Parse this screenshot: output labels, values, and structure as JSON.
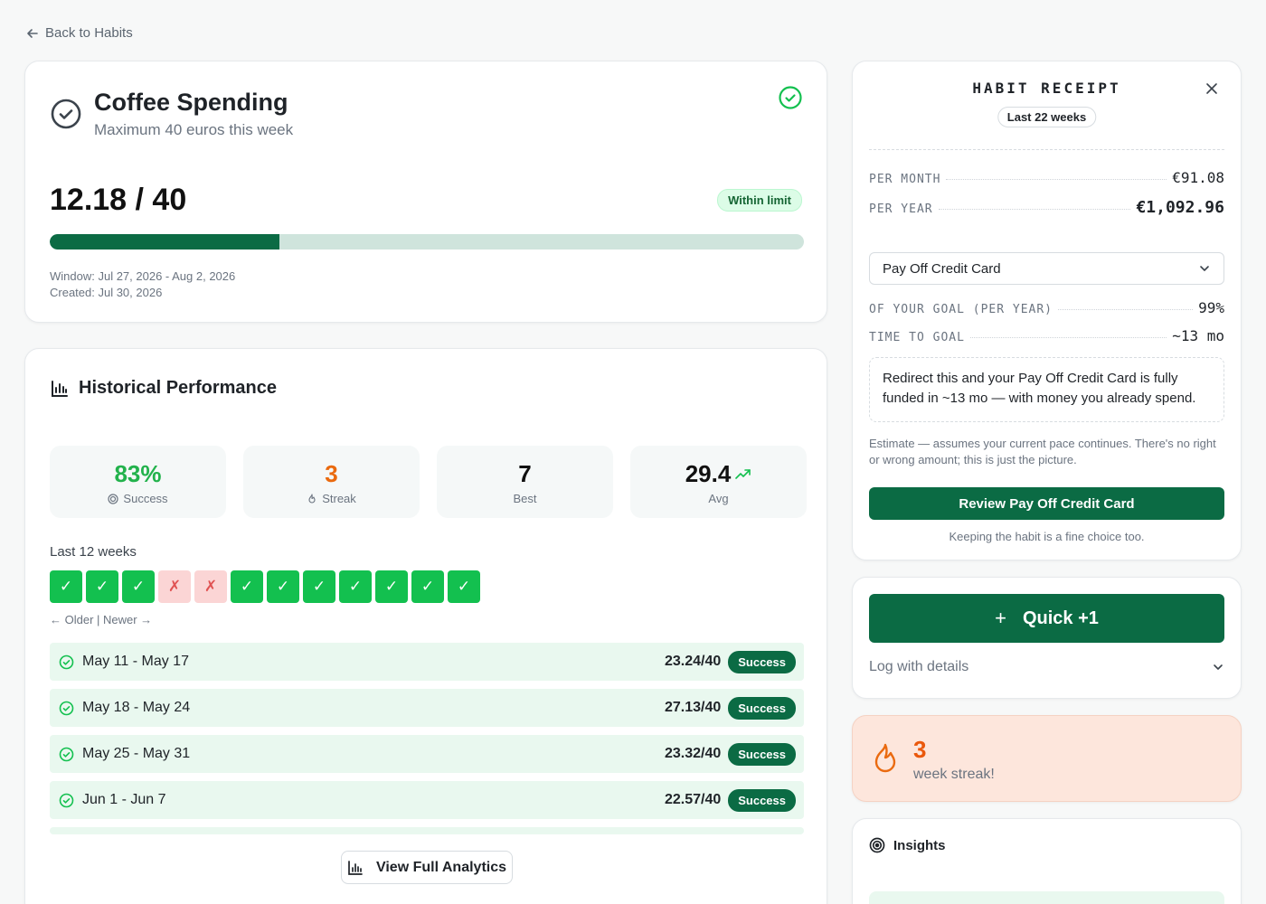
{
  "nav": {
    "back_label": "Back to Habits"
  },
  "habit": {
    "title": "Coffee Spending",
    "subtitle": "Maximum 40 euros this week",
    "value_display": "12.18 / 40",
    "status_badge": "Within limit",
    "progress_fraction": 0.3045,
    "window": "Window: Jul 27, 2026 - Aug 2, 2026",
    "created": "Created: Jul 30, 2026"
  },
  "history": {
    "title": "Historical Performance",
    "stats": {
      "success": {
        "value": "83%",
        "label": "Success"
      },
      "streak": {
        "value": "3",
        "label": "Streak"
      },
      "best": {
        "value": "7",
        "label": "Best"
      },
      "avg": {
        "value": "29.4",
        "label": "Avg"
      }
    },
    "last12_label": "Last 12 weeks",
    "weeks": [
      "✓",
      "✓",
      "✓",
      "✗",
      "✗",
      "✓",
      "✓",
      "✓",
      "✓",
      "✓",
      "✓",
      "✓"
    ],
    "older_newer": "← Older | Newer →",
    "rows": [
      {
        "label": "May 11 - May 17",
        "value": "23.24/40",
        "badge": "Success"
      },
      {
        "label": "May 18 - May 24",
        "value": "27.13/40",
        "badge": "Success"
      },
      {
        "label": "May 25 - May 31",
        "value": "23.32/40",
        "badge": "Success"
      },
      {
        "label": "Jun 1 - Jun 7",
        "value": "22.57/40",
        "badge": "Success"
      }
    ],
    "view_full_label": "View Full Analytics"
  },
  "receipt": {
    "title": "HABIT RECEIPT",
    "period_pill": "Last 22 weeks",
    "per_month_label": "PER MONTH",
    "per_month_value": "€91.08",
    "per_year_label": "PER YEAR",
    "per_year_value": "€1,092.96",
    "goal_select": "Pay Off Credit Card",
    "goal_pct_label": "OF YOUR GOAL (PER YEAR)",
    "goal_pct_value": "99%",
    "time_label": "TIME TO GOAL",
    "time_value": "~13 mo",
    "note": "Redirect this and your Pay Off Credit Card is fully funded in ~13 mo — with money you already spend.",
    "estimate": "Estimate — assumes your current pace continues. There's no right or wrong amount; this is just the picture.",
    "review_button": "Review Pay Off Credit Card",
    "keeping_text": "Keeping the habit is a fine choice too."
  },
  "quick": {
    "plus": "+",
    "button_label": "Quick +1",
    "log_label": "Log with details"
  },
  "streak": {
    "count": "3",
    "text": "week streak!"
  },
  "insights": {
    "title": "Insights"
  },
  "colors": {
    "brand_green": "#0b6b44",
    "success_green": "#13c04f",
    "fail_bg": "#fbd5d5",
    "streak_orange": "#ea580c"
  }
}
